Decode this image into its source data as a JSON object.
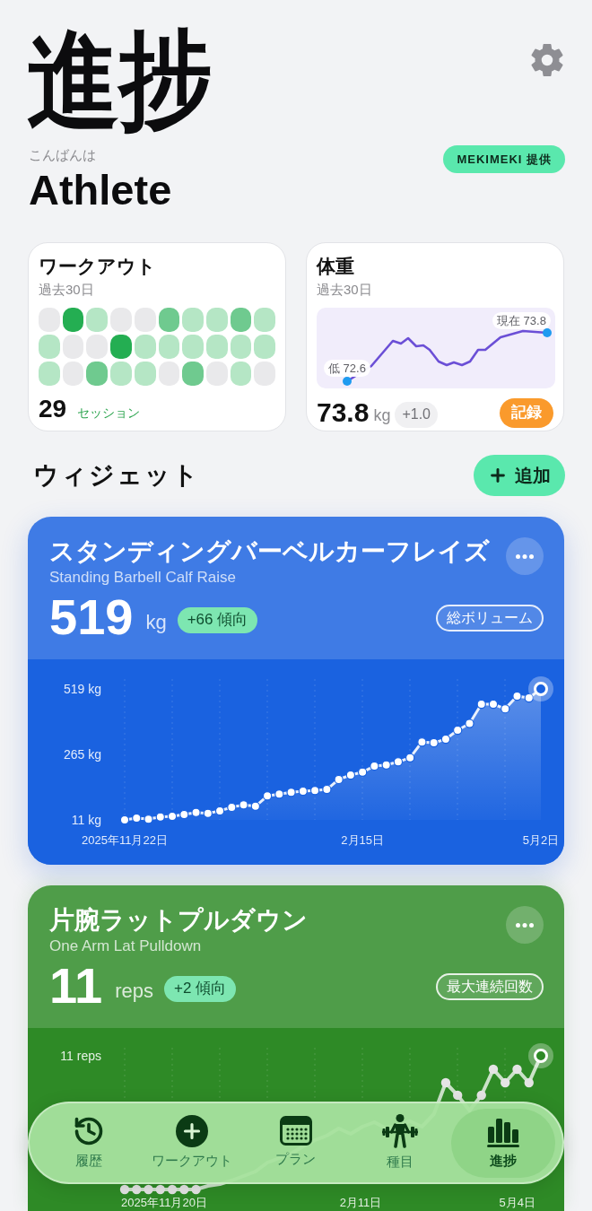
{
  "header": {
    "title": "進捗",
    "greeting": "こんばんは",
    "name": "Athlete",
    "badge": "MEKIMEKI 提供"
  },
  "workout_card": {
    "title": "ワークアウト",
    "period": "過去30日",
    "days": [
      {
        "color": "#e9e9eb"
      },
      {
        "color": "#24ae52"
      },
      {
        "color": "#b5e6c5"
      },
      {
        "color": "#e9e9eb"
      },
      {
        "color": "#e9e9eb"
      },
      {
        "color": "#6fca8f"
      },
      {
        "color": "#b5e6c5"
      },
      {
        "color": "#b5e6c5"
      },
      {
        "color": "#6fca8f"
      },
      {
        "color": "#b5e6c5"
      },
      {
        "color": "#b5e6c5"
      },
      {
        "color": "#e9e9eb"
      },
      {
        "color": "#e9e9eb"
      },
      {
        "color": "#24ae52"
      },
      {
        "color": "#b5e6c5"
      },
      {
        "color": "#b5e6c5"
      },
      {
        "color": "#b5e6c5"
      },
      {
        "color": "#b5e6c5"
      },
      {
        "color": "#b5e6c5"
      },
      {
        "color": "#b5e6c5"
      },
      {
        "color": "#b5e6c5"
      },
      {
        "color": "#e9e9eb"
      },
      {
        "color": "#6fca8f"
      },
      {
        "color": "#b5e6c5"
      },
      {
        "color": "#b5e6c5"
      },
      {
        "color": "#e9e9eb"
      },
      {
        "color": "#6fca8f"
      },
      {
        "color": "#e9e9eb"
      },
      {
        "color": "#b5e6c5"
      },
      {
        "color": "#e9e9eb"
      }
    ],
    "count": "29",
    "count_label": "セッション"
  },
  "weight_card": {
    "title": "体重",
    "period": "過去30日",
    "low_label": "低 72.6",
    "current_label": "現在 73.8",
    "value": "73.8",
    "unit": "kg",
    "change": "+1.0",
    "button": "記録"
  },
  "widgets_header": {
    "title": "ウィジェット",
    "add_button": "追加"
  },
  "widgets": [
    {
      "color": "#1a62e0",
      "title": "スタンディングバーベルカーフレイズ",
      "subtitle": "Standing Barbell Calf Raise",
      "value": "519",
      "unit": "kg",
      "trend": "+66 傾向",
      "metric": "総ボリューム",
      "chart_data": {
        "type": "area",
        "grid": true,
        "categories": [
          "2025年11月22日",
          null,
          null,
          null,
          null,
          null,
          null,
          null,
          null,
          null,
          null,
          null,
          null,
          null,
          null,
          null,
          null,
          null,
          null,
          null,
          "2月15日",
          null,
          null,
          null,
          null,
          null,
          null,
          null,
          null,
          null,
          null,
          null,
          null,
          null,
          null,
          "5月2日"
        ],
        "values": [
          11,
          18,
          14,
          22,
          25,
          32,
          40,
          36,
          46,
          60,
          69,
          64,
          104,
          111,
          118,
          122,
          125,
          129,
          168,
          185,
          196,
          220,
          224,
          236,
          252,
          313,
          310,
          324,
          359,
          385,
          460,
          460,
          442,
          491,
          484,
          519
        ],
        "ylim": [
          11,
          519
        ],
        "yticks": [
          {
            "value": 519,
            "label": "519 kg"
          },
          {
            "value": 265,
            "label": "265 kg"
          },
          {
            "value": 11,
            "label": "11 kg"
          }
        ]
      }
    },
    {
      "color": "#2e8a26",
      "title": "片腕ラットプルダウン",
      "subtitle": "One Arm Lat Pulldown",
      "value": "11",
      "unit": "reps",
      "trend": "+2 傾向",
      "metric": "最大連続回数",
      "y_label": "11 reps",
      "x_labels": [
        "2025年11月20日",
        "2月11日",
        "5月4日"
      ]
    }
  ],
  "tab_bar": [
    {
      "label": "履歴",
      "selected": false
    },
    {
      "label": "ワークアウト",
      "selected": false
    },
    {
      "label": "プラン",
      "selected": false
    },
    {
      "label": "種目",
      "selected": false
    },
    {
      "label": "進捗",
      "selected": true
    }
  ]
}
